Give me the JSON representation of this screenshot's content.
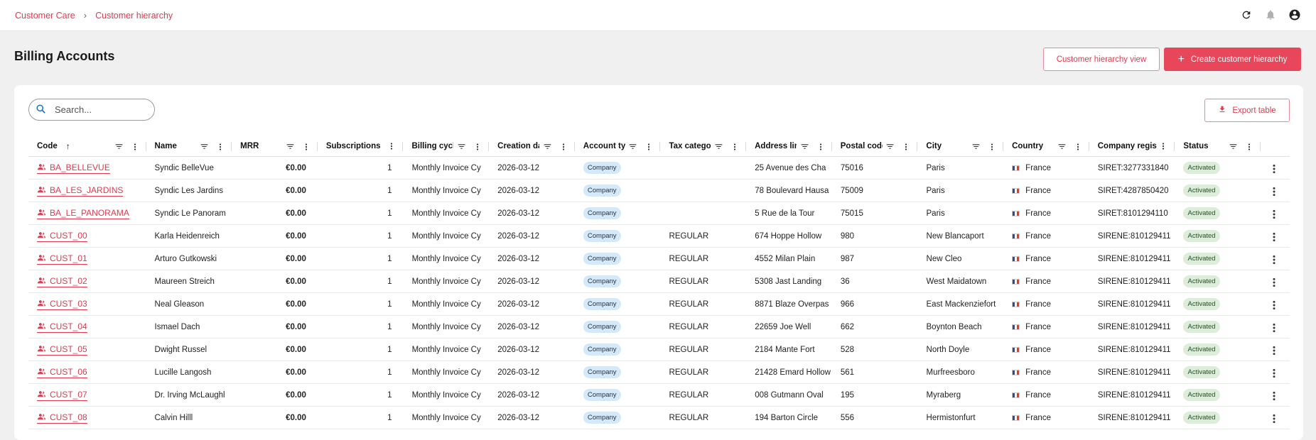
{
  "breadcrumb": {
    "root": "Customer Care",
    "current": "Customer hierarchy"
  },
  "header_icons": [
    "refresh-icon",
    "bell-icon",
    "account-circle-icon"
  ],
  "page": {
    "title": "Billing Accounts"
  },
  "actions": {
    "hierarchy_view": "Customer hierarchy view",
    "create": "Create customer hierarchy",
    "export": "Export table"
  },
  "search": {
    "placeholder": "Search...",
    "value": ""
  },
  "colors": {
    "accent": "#e8475b",
    "company_pill": "#d4e8f8",
    "status_pill": "#dcedd9"
  },
  "columns": [
    {
      "label": "Code",
      "sort": "asc"
    },
    {
      "label": "Name"
    },
    {
      "label": "MRR"
    },
    {
      "label": "Subscriptions"
    },
    {
      "label": "Billing cycle"
    },
    {
      "label": "Creation date"
    },
    {
      "label": "Account type"
    },
    {
      "label": "Tax category"
    },
    {
      "label": "Address line"
    },
    {
      "label": "Postal code"
    },
    {
      "label": "City"
    },
    {
      "label": "Country"
    },
    {
      "label": "Company registration"
    },
    {
      "label": "Status"
    }
  ],
  "rows": [
    {
      "code": "BA_BELLEVUE",
      "name": "Syndic BelleVue",
      "mrr": "€0.00",
      "subs": "1",
      "cycle": "Monthly Invoice Cy",
      "date": "2026-03-12",
      "type": "Company",
      "tax": "",
      "address": "25 Avenue des Cha",
      "postal": "75016",
      "city": "Paris",
      "country": "France",
      "reg": "SIRET:3277331840",
      "status": "Activated"
    },
    {
      "code": "BA_LES_JARDINS",
      "name": "Syndic Les Jardins",
      "mrr": "€0.00",
      "subs": "1",
      "cycle": "Monthly Invoice Cy",
      "date": "2026-03-12",
      "type": "Company",
      "tax": "",
      "address": "78 Boulevard Hausa",
      "postal": "75009",
      "city": "Paris",
      "country": "France",
      "reg": "SIRET:4287850420",
      "status": "Activated"
    },
    {
      "code": "BA_LE_PANORAMA",
      "name": "Syndic Le Panoram",
      "mrr": "€0.00",
      "subs": "1",
      "cycle": "Monthly Invoice Cy",
      "date": "2026-03-12",
      "type": "Company",
      "tax": "",
      "address": "5 Rue de la Tour",
      "postal": "75015",
      "city": "Paris",
      "country": "France",
      "reg": "SIRET:8101294110",
      "status": "Activated"
    },
    {
      "code": "CUST_00",
      "name": "Karla Heidenreich",
      "mrr": "€0.00",
      "subs": "1",
      "cycle": "Monthly Invoice Cy",
      "date": "2026-03-12",
      "type": "Company",
      "tax": "REGULAR",
      "address": "674 Hoppe Hollow",
      "postal": "980",
      "city": "New Blancaport",
      "country": "France",
      "reg": "SIRENE:810129411",
      "status": "Activated"
    },
    {
      "code": "CUST_01",
      "name": "Arturo Gutkowski",
      "mrr": "€0.00",
      "subs": "1",
      "cycle": "Monthly Invoice Cy",
      "date": "2026-03-12",
      "type": "Company",
      "tax": "REGULAR",
      "address": "4552 Milan Plain",
      "postal": "987",
      "city": "New Cleo",
      "country": "France",
      "reg": "SIRENE:810129411",
      "status": "Activated"
    },
    {
      "code": "CUST_02",
      "name": "Maureen Streich",
      "mrr": "€0.00",
      "subs": "1",
      "cycle": "Monthly Invoice Cy",
      "date": "2026-03-12",
      "type": "Company",
      "tax": "REGULAR",
      "address": "5308 Jast Landing",
      "postal": "36",
      "city": "West Maidatown",
      "country": "France",
      "reg": "SIRENE:810129411",
      "status": "Activated"
    },
    {
      "code": "CUST_03",
      "name": "Neal Gleason",
      "mrr": "€0.00",
      "subs": "1",
      "cycle": "Monthly Invoice Cy",
      "date": "2026-03-12",
      "type": "Company",
      "tax": "REGULAR",
      "address": "8871 Blaze Overpas",
      "postal": "966",
      "city": "East Mackenziefort",
      "country": "France",
      "reg": "SIRENE:810129411",
      "status": "Activated"
    },
    {
      "code": "CUST_04",
      "name": "Ismael Dach",
      "mrr": "€0.00",
      "subs": "1",
      "cycle": "Monthly Invoice Cy",
      "date": "2026-03-12",
      "type": "Company",
      "tax": "REGULAR",
      "address": "22659 Joe Well",
      "postal": "662",
      "city": "Boynton Beach",
      "country": "France",
      "reg": "SIRENE:810129411",
      "status": "Activated"
    },
    {
      "code": "CUST_05",
      "name": "Dwight Russel",
      "mrr": "€0.00",
      "subs": "1",
      "cycle": "Monthly Invoice Cy",
      "date": "2026-03-12",
      "type": "Company",
      "tax": "REGULAR",
      "address": "2184 Mante Fort",
      "postal": "528",
      "city": "North Doyle",
      "country": "France",
      "reg": "SIRENE:810129411",
      "status": "Activated"
    },
    {
      "code": "CUST_06",
      "name": "Lucille Langosh",
      "mrr": "€0.00",
      "subs": "1",
      "cycle": "Monthly Invoice Cy",
      "date": "2026-03-12",
      "type": "Company",
      "tax": "REGULAR",
      "address": "21428 Emard Hollow",
      "postal": "561",
      "city": "Murfreesboro",
      "country": "France",
      "reg": "SIRENE:810129411",
      "status": "Activated"
    },
    {
      "code": "CUST_07",
      "name": "Dr. Irving McLaughl",
      "mrr": "€0.00",
      "subs": "1",
      "cycle": "Monthly Invoice Cy",
      "date": "2026-03-12",
      "type": "Company",
      "tax": "REGULAR",
      "address": "008 Gutmann Oval",
      "postal": "195",
      "city": "Myraberg",
      "country": "France",
      "reg": "SIRENE:810129411",
      "status": "Activated"
    },
    {
      "code": "CUST_08",
      "name": "Calvin Hilll",
      "mrr": "€0.00",
      "subs": "1",
      "cycle": "Monthly Invoice Cy",
      "date": "2026-03-12",
      "type": "Company",
      "tax": "REGULAR",
      "address": "194 Barton Circle",
      "postal": "556",
      "city": "Hermistonfurt",
      "country": "France",
      "reg": "SIRENE:810129411",
      "status": "Activated"
    }
  ]
}
